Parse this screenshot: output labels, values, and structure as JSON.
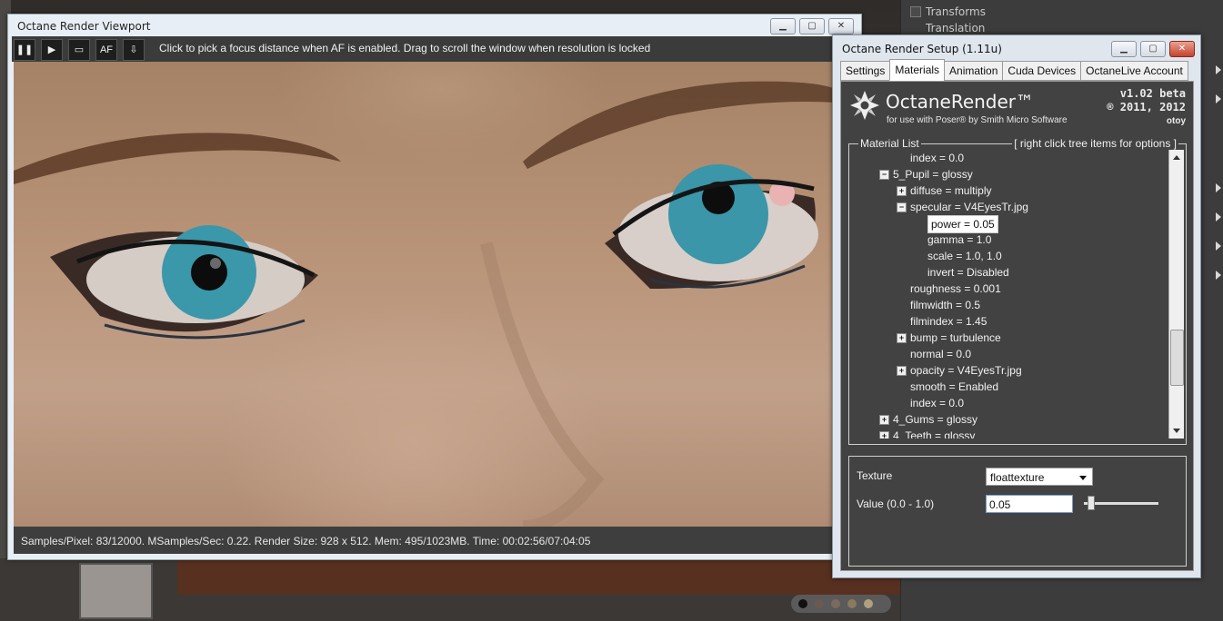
{
  "host": {
    "right_panel_rows": [
      "Transforms",
      "Translation"
    ]
  },
  "viewport": {
    "title": "Octane Render Viewport",
    "toolbar": {
      "pause_icon": "pause-icon",
      "play_icon": "play-icon",
      "monitor_icon": "monitor-icon",
      "af_label": "AF",
      "export_icon": "export-icon",
      "hint": "Click to pick a focus distance when AF is enabled.  Drag to scroll the window when resolution is locked"
    },
    "status": "Samples/Pixel: 83/12000. MSamples/Sec: 0.22. Render Size: 928 x 512. Mem: 495/1023MB. Time: 00:02:56/07:04:05"
  },
  "setup": {
    "title": "Octane Render Setup (1.11u)",
    "tabs": [
      {
        "label": "Settings"
      },
      {
        "label": "Materials",
        "active": true
      },
      {
        "label": "Animation"
      },
      {
        "label": "Cuda Devices"
      },
      {
        "label": "OctaneLive Account"
      }
    ],
    "logo": {
      "title": "OctaneRender™",
      "subtitle": "for use with Poser® by Smith Micro Software",
      "version": "v1.02 beta",
      "year": "® 2011, 2012",
      "brand": "otoy"
    },
    "material_list": {
      "label": "Material List",
      "hint": "[ right click tree items for options ]",
      "items": [
        {
          "text": "index = 0.0",
          "level": 2,
          "expander": ""
        },
        {
          "text": "5_Pupil = glossy",
          "level": 1,
          "expander": "−"
        },
        {
          "text": "diffuse = multiply",
          "level": 2,
          "expander": "+"
        },
        {
          "text": "specular = V4EyesTr.jpg",
          "level": 2,
          "expander": "−"
        },
        {
          "text": "power = 0.05",
          "level": 3,
          "expander": "",
          "selected": true
        },
        {
          "text": "gamma = 1.0",
          "level": 3,
          "expander": ""
        },
        {
          "text": "scale = 1.0, 1.0",
          "level": 3,
          "expander": ""
        },
        {
          "text": "invert = Disabled",
          "level": 3,
          "expander": ""
        },
        {
          "text": "roughness = 0.001",
          "level": 2,
          "expander": ""
        },
        {
          "text": "filmwidth = 0.5",
          "level": 2,
          "expander": ""
        },
        {
          "text": "filmindex = 1.45",
          "level": 2,
          "expander": ""
        },
        {
          "text": "bump = turbulence",
          "level": 2,
          "expander": "+"
        },
        {
          "text": "normal = 0.0",
          "level": 2,
          "expander": ""
        },
        {
          "text": "opacity = V4EyesTr.jpg",
          "level": 2,
          "expander": "+"
        },
        {
          "text": "smooth = Enabled",
          "level": 2,
          "expander": ""
        },
        {
          "text": "index = 0.0",
          "level": 2,
          "expander": ""
        },
        {
          "text": "4_Gums = glossy",
          "level": 1,
          "expander": "+"
        },
        {
          "text": "4_Teeth = glossy",
          "level": 1,
          "expander": "+"
        }
      ]
    },
    "properties": {
      "texture_label": "Texture",
      "texture_value": "floattexture",
      "value_label": "Value (0.0 - 1.0)",
      "value": "0.05",
      "slider_fraction": 0.05
    }
  },
  "colors": {
    "panel_bg": "#424242",
    "window_chrome": "#dfe6ee",
    "close_button": "#c5432d"
  }
}
